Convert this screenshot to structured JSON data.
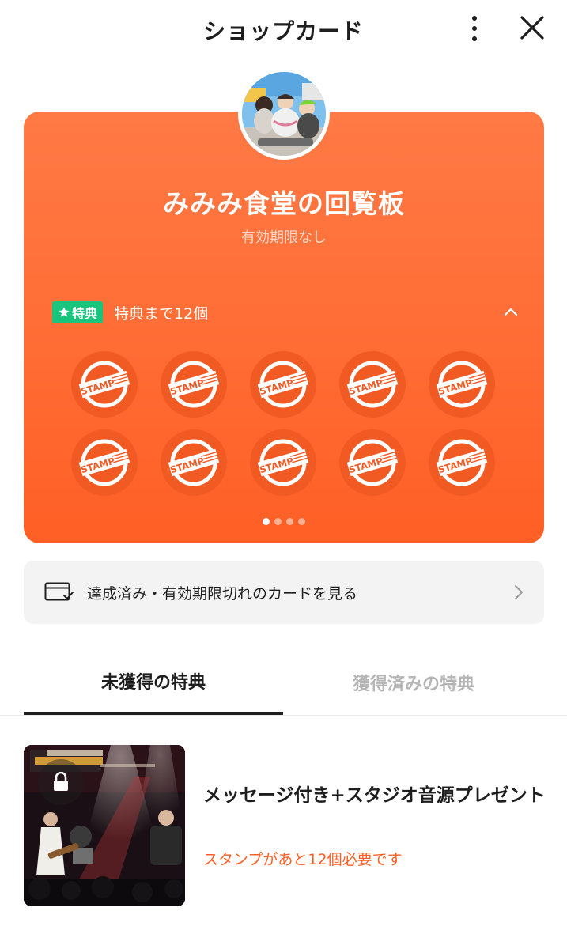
{
  "header": {
    "title": "ショップカード",
    "more_icon": "more-vertical-icon",
    "close_icon": "close-icon"
  },
  "card": {
    "title": "みみみ食堂の回覧板",
    "subtitle": "有効期限なし",
    "background_color": "#ff6c34",
    "benefit_badge": "特典",
    "benefit_badge_icon": "star-icon",
    "benefit_text": "特典まで12個",
    "stamp_label": "STAMP",
    "stamps": [
      {
        "label": "STAMP"
      },
      {
        "label": "STAMP"
      },
      {
        "label": "STAMP"
      },
      {
        "label": "STAMP"
      },
      {
        "label": "STAMP"
      },
      {
        "label": "STAMP"
      },
      {
        "label": "STAMP"
      },
      {
        "label": "STAMP"
      },
      {
        "label": "STAMP"
      },
      {
        "label": "STAMP"
      }
    ],
    "page_indicator": {
      "total": 4,
      "current": 1
    }
  },
  "archive": {
    "label": "達成済み・有効期限切れのカードを見る"
  },
  "tabs": [
    {
      "label": "未獲得の特典",
      "active": true
    },
    {
      "label": "獲得済みの特典",
      "active": false
    }
  ],
  "reward": {
    "title": "メッセージ付き+スタジオ音源プレゼント",
    "status": "スタンプがあと12個必要です",
    "locked": true,
    "image_text": "THE LIVE HOUSE CHICKEN GEORGE",
    "accent_color": "#ff5f25"
  }
}
